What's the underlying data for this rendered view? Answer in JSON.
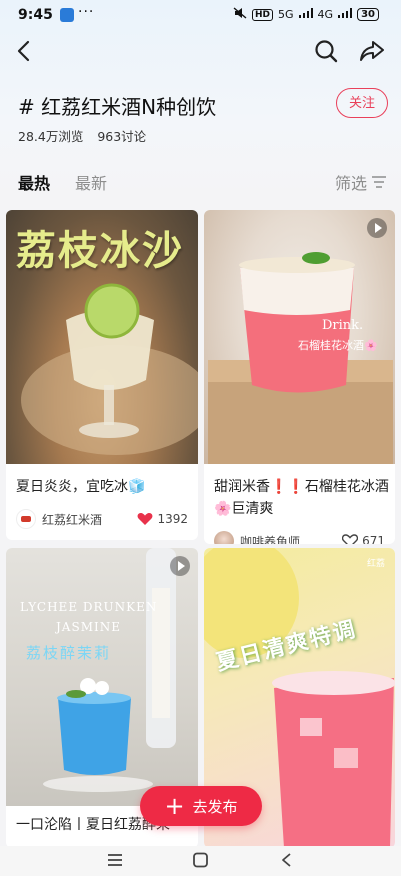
{
  "status_bar": {
    "time": "9:45",
    "more": "···",
    "hd": "HD",
    "net1": "5G",
    "net2": "4G",
    "battery": "30"
  },
  "topic": {
    "title": "# 红荔红米酒N种创饮",
    "follow_label": "关注",
    "views": "28.4万浏览",
    "discussions": "963讨论"
  },
  "tabs": {
    "hot": "最热",
    "latest": "最新",
    "filter": "筛选"
  },
  "posts": [
    {
      "overlay": "荔枝冰沙",
      "title": "夏日炎炎，宜吃冰🧊",
      "author": "红荔红米酒",
      "likes": "1392",
      "liked": true
    },
    {
      "overlay_en": "Drink.",
      "overlay_cn": "石榴桂花冰酒🌸",
      "title": "甜润米香❗❗石榴桂花冰酒🌸巨清爽",
      "author": "咖啡养鱼师",
      "likes": "671",
      "liked": false,
      "video": true
    },
    {
      "overlay_en1": "LYCHEE DRUNKEN",
      "overlay_en2": "JASMINE",
      "overlay_cn": "荔枝醉茉莉",
      "title": "一口沦陷丨夏日红荔醉茉",
      "video": true
    },
    {
      "overlay_cn": "夏日清爽特调",
      "brand": "红荔"
    }
  ],
  "fab": {
    "label": "去发布"
  },
  "colors": {
    "accent": "#ee2a45",
    "follow": "#e9405a"
  }
}
